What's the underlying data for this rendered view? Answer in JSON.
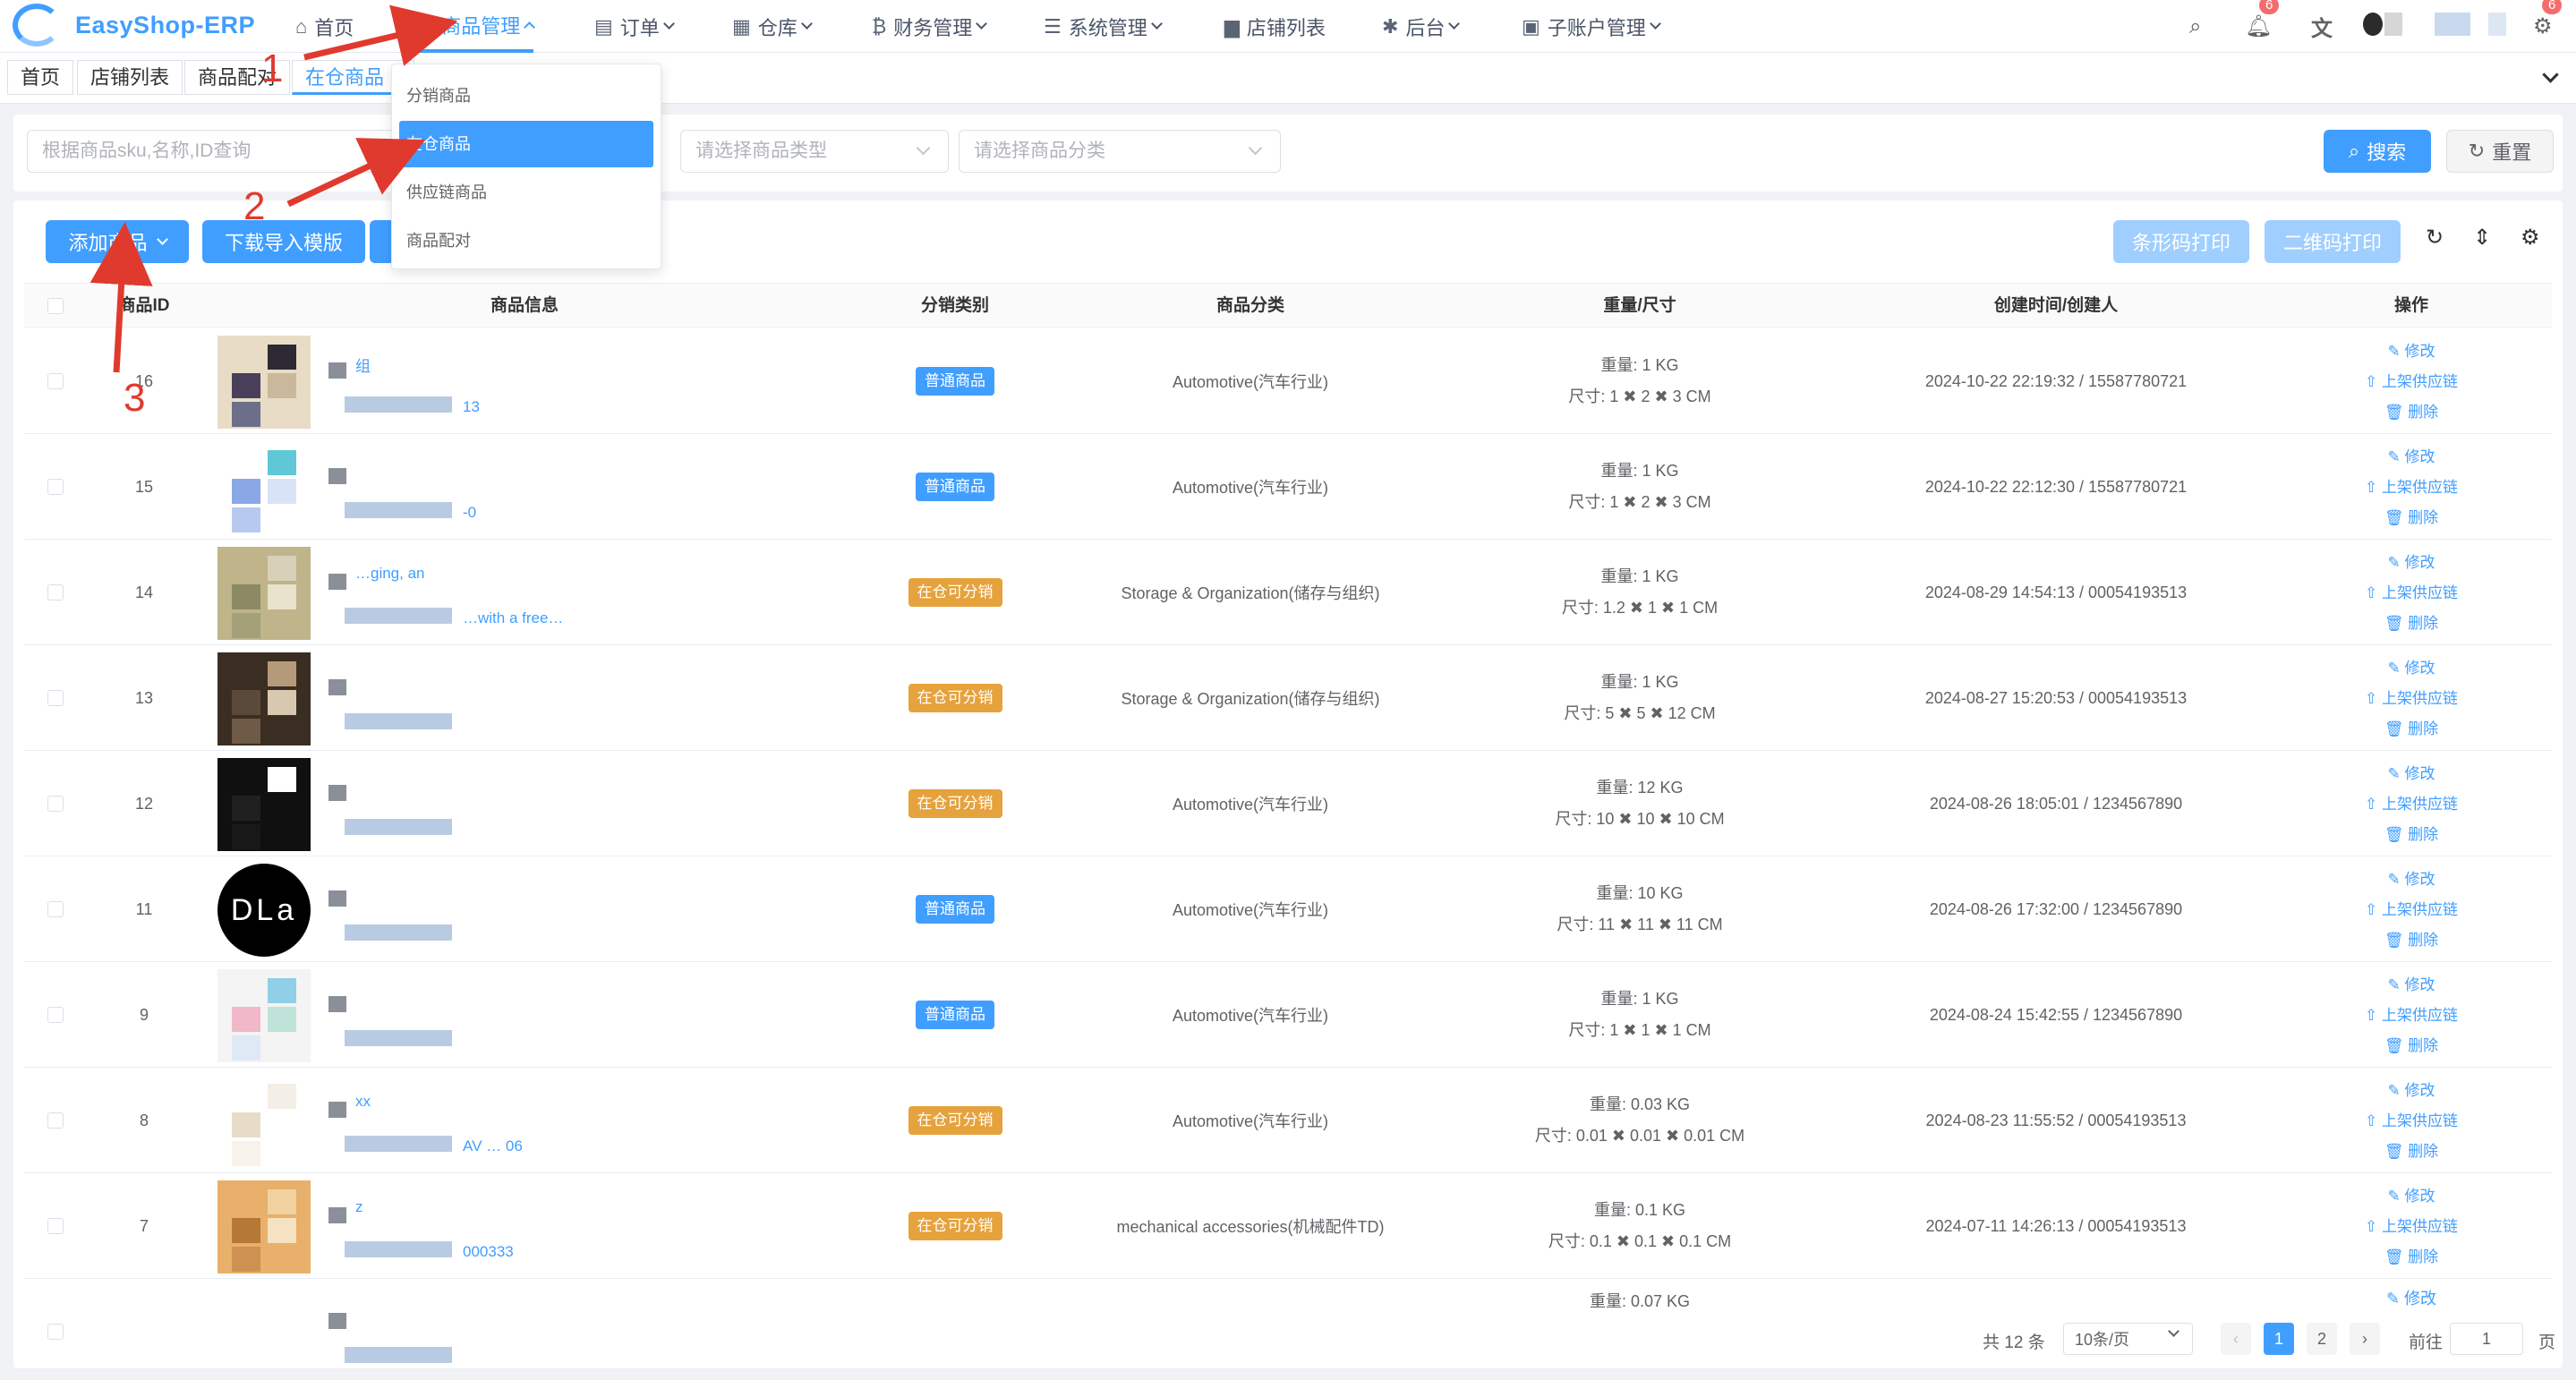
{
  "app": {
    "name": "EasyShop-ERP"
  },
  "nav": {
    "items": [
      {
        "label": "首页",
        "icon": "home-icon"
      },
      {
        "label": "商品管理",
        "icon": "goods-icon"
      },
      {
        "label": "订单",
        "icon": "order-icon"
      },
      {
        "label": "仓库",
        "icon": "warehouse-icon"
      },
      {
        "label": "财务管理",
        "icon": "bitcoin-icon"
      },
      {
        "label": "系统管理",
        "icon": "sliders-icon"
      },
      {
        "label": "店铺列表",
        "icon": "shop-icon"
      },
      {
        "label": "后台",
        "icon": "bug-icon"
      },
      {
        "label": "子账户管理",
        "icon": "subaccount-icon"
      }
    ],
    "notification_count": "6"
  },
  "tags": [
    {
      "label": "首页"
    },
    {
      "label": "店铺列表"
    },
    {
      "label": "商品配对"
    },
    {
      "label": "在仓商品"
    }
  ],
  "dropdown": {
    "items": [
      "分销商品",
      "在仓商品",
      "供应链商品",
      "商品配对"
    ],
    "active_index": 1
  },
  "search": {
    "keyword_placeholder": "根据商品sku,名称,ID查询",
    "type_placeholder": "请选择商品类型",
    "category_placeholder": "请选择商品分类",
    "search_label": "搜索",
    "reset_label": "重置"
  },
  "toolbar": {
    "add_label": "添加商品",
    "download_label": "下载导入模版",
    "barcode_label": "条形码打印",
    "qrcode_label": "二维码打印"
  },
  "table": {
    "headers": [
      "商品ID",
      "商品信息",
      "分销类别",
      "商品分类",
      "重量/尺寸",
      "创建时间/创建人",
      "操作"
    ],
    "op_labels": [
      "修改",
      "上架供应链",
      "删除"
    ],
    "rows": [
      {
        "id": "16",
        "info_text": "组",
        "info_sub": "13",
        "type": "普通商品",
        "type_color": "blue",
        "category": "Automotive(汽车行业)",
        "weight": "重量: 1 KG",
        "size": "尺寸: 1 ✖ 2 ✖ 3 CM",
        "created": "2024-10-22 22:19:32 / 15587780721"
      },
      {
        "id": "15",
        "info_text": "",
        "info_sub": "-0",
        "type": "普通商品",
        "type_color": "blue",
        "category": "Automotive(汽车行业)",
        "weight": "重量: 1 KG",
        "size": "尺寸: 1 ✖ 2 ✖ 3 CM",
        "created": "2024-10-22 22:12:30 / 15587780721"
      },
      {
        "id": "14",
        "info_text": "…ging, an",
        "info_sub": "…with a free…",
        "type": "在仓可分销",
        "type_color": "orange",
        "category": "Storage & Organization(储存与组织)",
        "weight": "重量: 1 KG",
        "size": "尺寸: 1.2 ✖ 1 ✖ 1 CM",
        "created": "2024-08-29 14:54:13 / 00054193513"
      },
      {
        "id": "13",
        "info_text": "",
        "info_sub": "",
        "type": "在仓可分销",
        "type_color": "orange",
        "category": "Storage & Organization(储存与组织)",
        "weight": "重量: 1 KG",
        "size": "尺寸: 5 ✖ 5 ✖ 12 CM",
        "created": "2024-08-27 15:20:53 / 00054193513"
      },
      {
        "id": "12",
        "info_text": "",
        "info_sub": "",
        "type": "在仓可分销",
        "type_color": "orange",
        "category": "Automotive(汽车行业)",
        "weight": "重量: 12 KG",
        "size": "尺寸: 10 ✖ 10 ✖ 10 CM",
        "created": "2024-08-26 18:05:01 / 1234567890"
      },
      {
        "id": "11",
        "info_text": "",
        "info_sub": "",
        "type": "普通商品",
        "type_color": "blue",
        "category": "Automotive(汽车行业)",
        "weight": "重量: 10 KG",
        "size": "尺寸: 11 ✖ 11 ✖ 11 CM",
        "created": "2024-08-26 17:32:00 / 1234567890"
      },
      {
        "id": "9",
        "info_text": "",
        "info_sub": "",
        "type": "普通商品",
        "type_color": "blue",
        "category": "Automotive(汽车行业)",
        "weight": "重量: 1 KG",
        "size": "尺寸: 1 ✖ 1 ✖ 1 CM",
        "created": "2024-08-24 15:42:55 / 1234567890"
      },
      {
        "id": "8",
        "info_text": "xx",
        "info_sub": "AV … 06",
        "type": "在仓可分销",
        "type_color": "orange",
        "category": "Automotive(汽车行业)",
        "weight": "重量: 0.03 KG",
        "size": "尺寸: 0.01 ✖ 0.01 ✖ 0.01 CM",
        "created": "2024-08-23 11:55:52 / 00054193513"
      },
      {
        "id": "7",
        "info_text": "z",
        "info_sub": "000333",
        "type": "在仓可分销",
        "type_color": "orange",
        "category": "mechanical accessories(机械配件TD)",
        "weight": "重量: 0.1 KG",
        "size": "尺寸: 0.1 ✖ 0.1 ✖ 0.1 CM",
        "created": "2024-07-11 14:26:13 / 00054193513"
      },
      {
        "id": "",
        "info_text": "",
        "info_sub": "",
        "type": "",
        "type_color": "blue",
        "category": "",
        "weight": "重量: 0.07 KG",
        "size": "",
        "created": ""
      }
    ]
  },
  "pagination": {
    "total": "共 12 条",
    "page_size": "10条/页",
    "pages": [
      "1",
      "2"
    ],
    "current": "1",
    "goto_label": "前往",
    "goto_value": "1",
    "page_unit": "页"
  },
  "annotations": [
    "1",
    "2",
    "3"
  ],
  "colors": {
    "primary": "#409eff",
    "warning": "#e6a23c",
    "annotation": "#e03a2e"
  }
}
